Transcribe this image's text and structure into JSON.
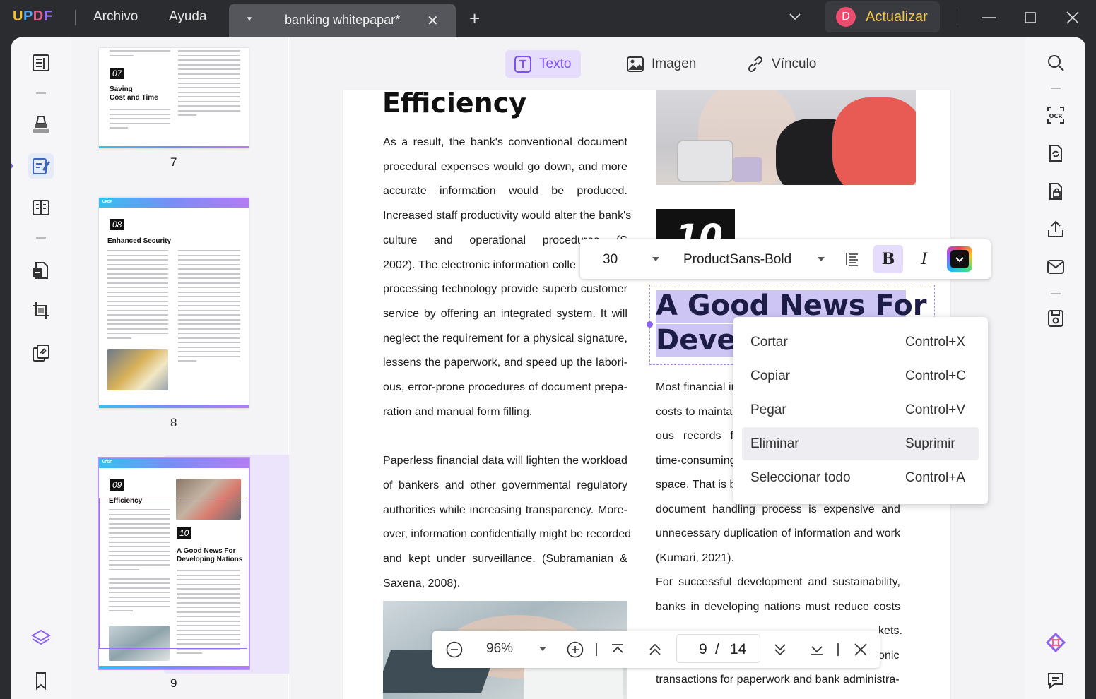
{
  "app": {
    "logo_letters": [
      "U",
      "P",
      "D",
      "F"
    ],
    "menu": [
      "Archivo",
      "Ayuda"
    ],
    "tab_title": "banking whitepapar*",
    "avatar_initial": "D",
    "upgrade_label": "Actualizar"
  },
  "toolbar": {
    "text_label": "Texto",
    "image_label": "Imagen",
    "link_label": "Vínculo"
  },
  "thumbnails": [
    {
      "page_label": "7",
      "num": "07",
      "title": "Saving\nCost and Time"
    },
    {
      "page_label": "8",
      "num": "08",
      "title": "Enhanced Security"
    },
    {
      "page_label": "9",
      "num": "09",
      "title": "Efficiency",
      "num2": "10",
      "title2": "A Good News For\nDeveloping Nations"
    }
  ],
  "thumb_logo": "UPDF",
  "document": {
    "heading": "Efficiency",
    "left_col": [
      "As a result, the bank's conventional document",
      "procedural expenses would go down, and more",
      "accurate information would be produced.",
      "Increased staff productivity would alter the bank's",
      "culture and operational procedures (S",
      "2002). The electronic information colle",
      "processing technology provide superb customer",
      "service by offering an integrated system. It will",
      "neglect the requirement for a physical signature,",
      "lessens the paperwork, and speed up the labori-",
      "ous, error-prone procedures of document prepa-",
      "ration and manual form filling.",
      "",
      "Paperless financial data will lighten the workload",
      "of bankers and other governmental regulatory",
      "authorities while increasing transparency. More-",
      "over, information confidentially might be recorded",
      "and kept under surveillance. (Subramanian &",
      "Saxena, 2008)."
    ],
    "section_number": "10",
    "title_line1": "A Good News For",
    "title_line2": "Devel",
    "right_col": [
      "Most financial in",
      "costs to mainta",
      "ous records f",
      "time-consuming",
      "space. That is b",
      "document handling process is expensive and",
      "unnecessary duplication of information and work",
      "(Kumari, 2021).",
      "For successful development and sustainability,",
      "banks in developing nations must reduce costs",
      "kets.",
      "onic",
      "transactions for paperwork and bank administra-"
    ]
  },
  "format_bar": {
    "font_size": "30",
    "font_name": "ProductSans-Bold",
    "bold_label": "B",
    "italic_label": "I",
    "color": "#111111"
  },
  "context_menu": [
    {
      "label": "Cortar",
      "shortcut": "Control+X"
    },
    {
      "label": "Copiar",
      "shortcut": "Control+C"
    },
    {
      "label": "Pegar",
      "shortcut": "Control+V"
    },
    {
      "label": "Eliminar",
      "shortcut": "Suprimir"
    },
    {
      "label": "Seleccionar todo",
      "shortcut": "Control+A"
    }
  ],
  "page_nav": {
    "zoom": "96%",
    "current_page": "9",
    "separator": "/",
    "total_pages": "14"
  },
  "colors": {
    "accent": "#7c4ff1",
    "highlight": "#cdc6f5",
    "upgrade_text": "#f3c94c"
  }
}
